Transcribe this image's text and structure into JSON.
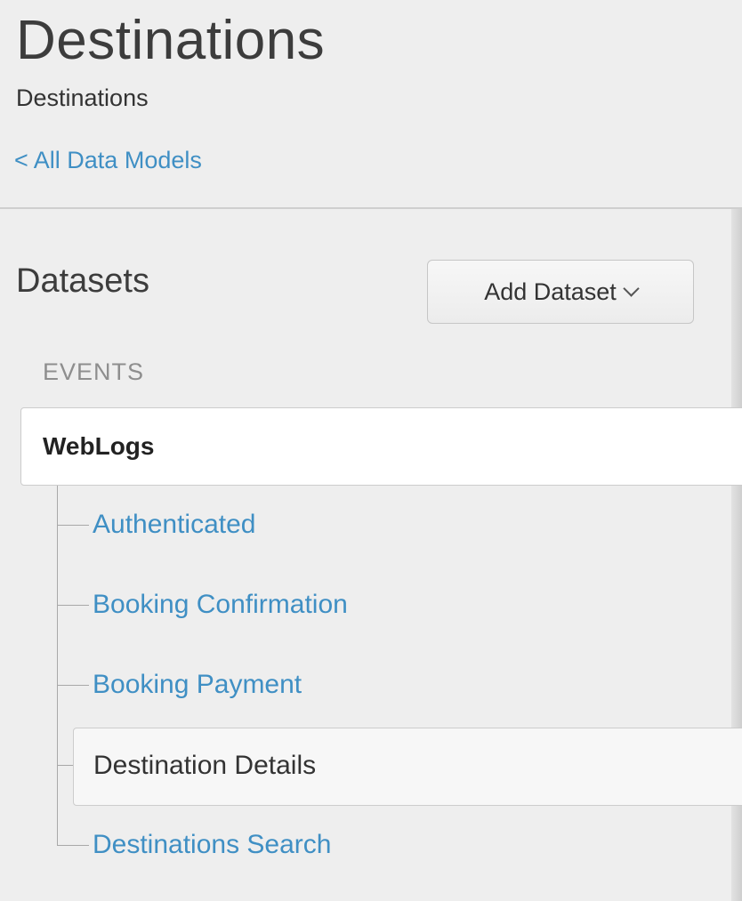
{
  "header": {
    "title": "Destinations",
    "subtitle": "Destinations",
    "back_link": "All Data Models",
    "back_chevron": "<"
  },
  "datasets": {
    "title": "Datasets",
    "add_button_label": "Add Dataset",
    "section_label": "EVENTS",
    "root": {
      "label": "WebLogs"
    },
    "children": [
      {
        "label": "Authenticated"
      },
      {
        "label": "Booking Confirmation"
      },
      {
        "label": "Booking Payment"
      },
      {
        "label": "Destination Details",
        "selected": true
      },
      {
        "label": "Destinations Search"
      }
    ]
  },
  "colors": {
    "link": "#3f8fc4",
    "background": "#eeeeee",
    "selected_bg": "#f7f7f7"
  }
}
